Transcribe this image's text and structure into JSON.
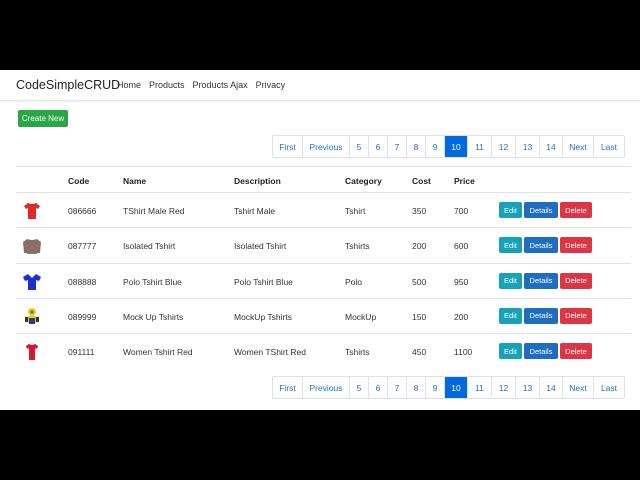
{
  "navbar": {
    "brand": "CodeSimpleCRUD",
    "links": [
      "Home",
      "Products",
      "Products Ajax",
      "Privacy"
    ]
  },
  "actions": {
    "create_label": "Create New"
  },
  "pagination": {
    "items": [
      "First",
      "Previous",
      "5",
      "6",
      "7",
      "8",
      "9",
      "10",
      "11",
      "12",
      "13",
      "14",
      "Next",
      "Last"
    ],
    "current": "10"
  },
  "table": {
    "headers": [
      "Code",
      "Name",
      "Description",
      "Category",
      "Cost",
      "Price"
    ],
    "rows": [
      {
        "image": "red-tshirt",
        "code": "086666",
        "name": "TShirt Male Red",
        "description": "Tshirt Male",
        "category": "Tshirt",
        "cost": "350",
        "price": "700"
      },
      {
        "image": "gray-tshirt",
        "code": "087777",
        "name": "Isolated Tshirt",
        "description": "Isolated Tshirt",
        "category": "Tshirts",
        "cost": "200",
        "price": "600"
      },
      {
        "image": "blue-polo",
        "code": "088888",
        "name": "Polo Tshirt Blue",
        "description": "Polo Tshirt Blue",
        "category": "Polo",
        "cost": "500",
        "price": "950"
      },
      {
        "image": "mockup-figure",
        "code": "089999",
        "name": "Mock Up Tshirts",
        "description": "MockUp Tshirts",
        "category": "MockUp",
        "cost": "150",
        "price": "200"
      },
      {
        "image": "women-red-tshirt",
        "code": "091111",
        "name": "Women Tshirt Red",
        "description": "Women TShirt Red",
        "category": "Tshirts",
        "cost": "450",
        "price": "1100"
      }
    ],
    "row_actions": {
      "edit": "Edit",
      "details": "Details",
      "delete": "Delete"
    }
  },
  "colors": {
    "create": "#28a745",
    "active_page": "#0069e0",
    "link": "#1a73c7",
    "edit": "#17a2b8",
    "details": "#1f6dc0",
    "delete": "#dc3545"
  }
}
